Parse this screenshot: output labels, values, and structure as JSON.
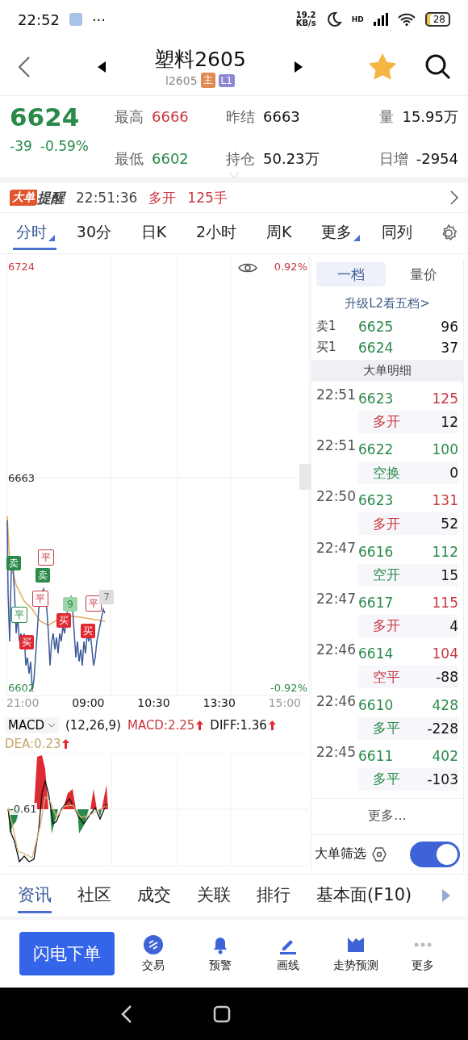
{
  "status_bar": {
    "time": "22:52",
    "more": "···",
    "speed_value": "19.2",
    "speed_unit": "KB/s",
    "network": "HD",
    "battery": "28"
  },
  "header": {
    "title": "塑料2605",
    "code": "l2605",
    "badges": [
      {
        "text": "主",
        "color": "#e08a52"
      },
      {
        "text": "L1",
        "color": "#8e86d6"
      }
    ],
    "favorite": true
  },
  "quote": {
    "price": "6624",
    "change": "-39",
    "change_pct": "-0.59%",
    "color": "#2a8a4a",
    "stats": [
      {
        "label": "最高",
        "value": "6666",
        "color": "#c8373f"
      },
      {
        "label": "昨结",
        "value": "6663",
        "color": "#111111"
      },
      {
        "label": "量",
        "value": "15.95万",
        "color": "#111111"
      },
      {
        "label": "最低",
        "value": "6602",
        "color": "#2a8a4a"
      },
      {
        "label": "持仓",
        "value": "50.23万",
        "color": "#111111"
      },
      {
        "label": "日增",
        "value": "-2954",
        "color": "#111111"
      }
    ]
  },
  "alert": {
    "badge": "大单",
    "badge_suffix": "提醒",
    "time": "22:51:36",
    "action": "多开",
    "amount": "125手"
  },
  "period_tabs": [
    {
      "label": "分时",
      "selected": true,
      "has_menu": true
    },
    {
      "label": "30分",
      "selected": false,
      "has_menu": false
    },
    {
      "label": "日K",
      "selected": false,
      "has_menu": false
    },
    {
      "label": "2小时",
      "selected": false,
      "has_menu": false
    },
    {
      "label": "周K",
      "selected": false,
      "has_menu": false
    },
    {
      "label": "更多",
      "selected": false,
      "has_menu": true
    },
    {
      "label": "同列",
      "selected": false,
      "has_menu": false
    }
  ],
  "price_chart": {
    "top_price": "6724",
    "mid_price": "6663",
    "bottom_price": "6602",
    "top_pct": "0.92%",
    "bottom_pct": "-0.92%",
    "markers": [
      {
        "text": "卖",
        "kind": "sell"
      },
      {
        "text": "平",
        "kind": "close"
      },
      {
        "text": "卖",
        "kind": "sell"
      },
      {
        "text": "平",
        "kind": "close"
      },
      {
        "text": "平",
        "kind": "close_short"
      },
      {
        "text": "买",
        "kind": "buy"
      },
      {
        "text": "9",
        "kind": "count"
      },
      {
        "text": "买",
        "kind": "buy"
      },
      {
        "text": "平",
        "kind": "close"
      },
      {
        "text": "买",
        "kind": "buy"
      },
      {
        "text": "7",
        "kind": "more"
      }
    ],
    "time_labels": [
      {
        "text": "21:00",
        "dim": true
      },
      {
        "text": "09:00",
        "dim": false
      },
      {
        "text": "10:30",
        "dim": false
      },
      {
        "text": "13:30",
        "dim": false
      },
      {
        "text": "15:00",
        "dim": true
      }
    ]
  },
  "macd": {
    "selector": "MACD",
    "params": "(12,26,9)",
    "values": [
      {
        "text": "MACD:2.25",
        "kind": "macd"
      },
      {
        "text": "DIFF:1.36",
        "kind": "diff"
      },
      {
        "text": "DEA:0.23",
        "kind": "dea"
      }
    ],
    "zero_label": "-0.61"
  },
  "side_panel": {
    "tabs": [
      {
        "label": "一档",
        "selected": true
      },
      {
        "label": "量价",
        "selected": false
      }
    ],
    "upgrade_link": "升级L2看五档>",
    "book": [
      {
        "label": "卖1",
        "price": "6625",
        "volume": "96"
      },
      {
        "label": "买1",
        "price": "6624",
        "volume": "37"
      }
    ],
    "section_title": "大单明细",
    "trades": [
      {
        "time": "22:51",
        "price": "6623",
        "volume": "125",
        "type": "多开",
        "change": "12",
        "color": "#c8373f"
      },
      {
        "time": "22:51",
        "price": "6622",
        "volume": "100",
        "type": "空换",
        "change": "0",
        "color": "#2a8a4a"
      },
      {
        "time": "22:50",
        "price": "6623",
        "volume": "131",
        "type": "多开",
        "change": "52",
        "color": "#c8373f"
      },
      {
        "time": "22:47",
        "price": "6616",
        "volume": "112",
        "type": "空开",
        "change": "15",
        "color": "#2a8a4a"
      },
      {
        "time": "22:47",
        "price": "6617",
        "volume": "115",
        "type": "多开",
        "change": "4",
        "color": "#c8373f"
      },
      {
        "time": "22:46",
        "price": "6614",
        "volume": "104",
        "type": "空平",
        "change": "-88",
        "color": "#c8373f"
      },
      {
        "time": "22:46",
        "price": "6610",
        "volume": "428",
        "type": "多平",
        "change": "-228",
        "color": "#2a8a4a"
      },
      {
        "time": "22:45",
        "price": "6611",
        "volume": "402",
        "type": "多平",
        "change": "-103",
        "color": "#2a8a4a"
      }
    ],
    "more": "更多...",
    "filter": {
      "label": "大单筛选",
      "on": true
    }
  },
  "bottom_tabs": [
    {
      "label": "资讯",
      "selected": true
    },
    {
      "label": "社区",
      "selected": false
    },
    {
      "label": "成交",
      "selected": false
    },
    {
      "label": "关联",
      "selected": false
    },
    {
      "label": "排行",
      "selected": false
    },
    {
      "label": "基本面(F10)",
      "selected": false
    }
  ],
  "actions": {
    "primary": "闪电下单",
    "items": [
      {
        "label": "交易",
        "kind": "trade"
      },
      {
        "label": "预警",
        "kind": "alert"
      },
      {
        "label": "画线",
        "kind": "draw"
      },
      {
        "label": "走势预测",
        "kind": "forecast"
      },
      {
        "label": "更多",
        "kind": "more"
      }
    ]
  }
}
